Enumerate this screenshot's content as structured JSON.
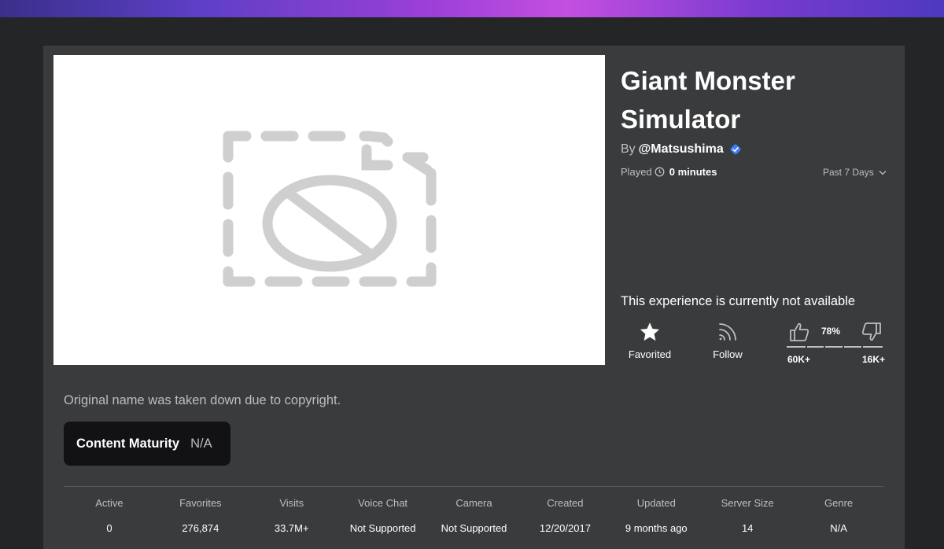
{
  "title": "Giant Monster Simulator",
  "creator": {
    "prefix": "By",
    "name": "@Matsushima",
    "verified": true
  },
  "played": {
    "label": "Played",
    "value": "0 minutes",
    "period": "Past 7 Days"
  },
  "availability": "This experience is currently not available",
  "actions": {
    "favorite": "Favorited",
    "follow": "Follow"
  },
  "votes": {
    "percent": "78%",
    "up": "60K+",
    "down": "16K+"
  },
  "description": "Original name was taken down due to copyright.",
  "maturity": {
    "label": "Content Maturity",
    "value": "N/A"
  },
  "stats": [
    {
      "label": "Active",
      "value": "0"
    },
    {
      "label": "Favorites",
      "value": "276,874"
    },
    {
      "label": "Visits",
      "value": "33.7M+"
    },
    {
      "label": "Voice Chat",
      "value": "Not Supported"
    },
    {
      "label": "Camera",
      "value": "Not Supported"
    },
    {
      "label": "Created",
      "value": "12/20/2017"
    },
    {
      "label": "Updated",
      "value": "9 months ago"
    },
    {
      "label": "Server Size",
      "value": "14"
    },
    {
      "label": "Genre",
      "value": "N/A"
    }
  ],
  "icons": {
    "thumbnail": "broken-image-icon",
    "verified": "verified-badge-icon",
    "clock": "clock-icon",
    "chevron": "chevron-down-icon",
    "favorite": "star-icon",
    "follow": "rss-icon",
    "upvote": "thumbs-up-icon",
    "downvote": "thumbs-down-icon"
  },
  "colors": {
    "background": "#232527",
    "panel": "#393b3d",
    "accent": "#3d7eff"
  }
}
